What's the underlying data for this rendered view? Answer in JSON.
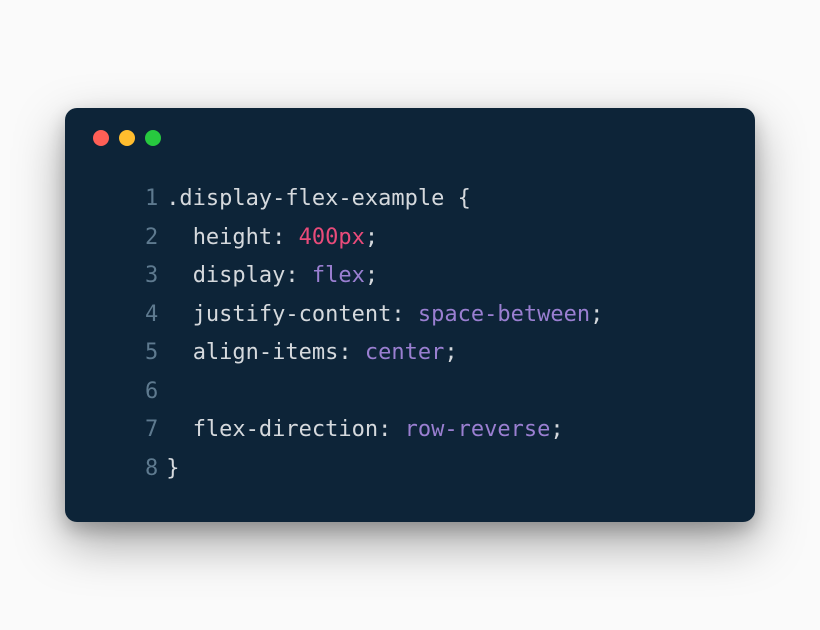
{
  "window": {
    "traffic_lights": {
      "red": "#ff5f56",
      "yellow": "#ffbd2e",
      "green": "#27c93f"
    },
    "background": "#0d2438"
  },
  "code": {
    "lines": [
      {
        "num": "1",
        "indent": "",
        "tokens": [
          {
            "t": ".display-flex-example ",
            "c": "tok-selector"
          },
          {
            "t": "{",
            "c": "tok-brace"
          }
        ]
      },
      {
        "num": "2",
        "indent": "  ",
        "tokens": [
          {
            "t": "height",
            "c": "tok-property"
          },
          {
            "t": ": ",
            "c": "tok-punct"
          },
          {
            "t": "400",
            "c": "tok-number"
          },
          {
            "t": "px",
            "c": "tok-unit"
          },
          {
            "t": ";",
            "c": "tok-punct"
          }
        ]
      },
      {
        "num": "3",
        "indent": "  ",
        "tokens": [
          {
            "t": "display",
            "c": "tok-property"
          },
          {
            "t": ": ",
            "c": "tok-punct"
          },
          {
            "t": "flex",
            "c": "tok-value"
          },
          {
            "t": ";",
            "c": "tok-punct"
          }
        ]
      },
      {
        "num": "4",
        "indent": "  ",
        "tokens": [
          {
            "t": "justify-content",
            "c": "tok-property"
          },
          {
            "t": ": ",
            "c": "tok-punct"
          },
          {
            "t": "space-between",
            "c": "tok-value"
          },
          {
            "t": ";",
            "c": "tok-punct"
          }
        ]
      },
      {
        "num": "5",
        "indent": "  ",
        "tokens": [
          {
            "t": "align-items",
            "c": "tok-property"
          },
          {
            "t": ": ",
            "c": "tok-punct"
          },
          {
            "t": "center",
            "c": "tok-value"
          },
          {
            "t": ";",
            "c": "tok-punct"
          }
        ]
      },
      {
        "num": "6",
        "indent": "",
        "tokens": []
      },
      {
        "num": "7",
        "indent": "  ",
        "tokens": [
          {
            "t": "flex-direction",
            "c": "tok-property"
          },
          {
            "t": ": ",
            "c": "tok-punct"
          },
          {
            "t": "row-reverse",
            "c": "tok-value"
          },
          {
            "t": ";",
            "c": "tok-punct"
          }
        ]
      },
      {
        "num": "8",
        "indent": "",
        "tokens": [
          {
            "t": "}",
            "c": "tok-brace"
          }
        ]
      }
    ]
  }
}
